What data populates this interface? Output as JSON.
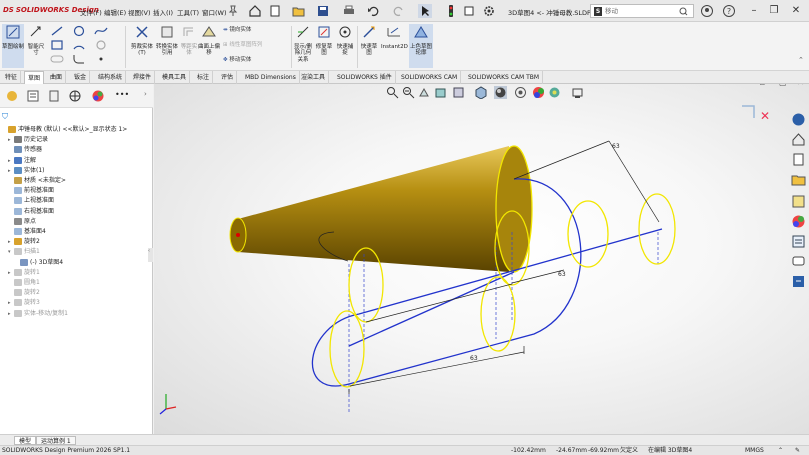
{
  "app": {
    "brand": "SOLIDWORKS Design",
    "document_title": "3D草图4 <- 冲锤母教.SLDPR...",
    "search_placeholder": "移动"
  },
  "menu": [
    "文件(F)",
    "编辑(E)",
    "视图(V)",
    "插入(I)",
    "工具(T)",
    "窗口(W)"
  ],
  "command_manager": {
    "big_buttons": [
      {
        "label": "草图绘制"
      },
      {
        "label": "智能尺寸"
      },
      {
        "label": "剪裁实体(T)"
      },
      {
        "label": "转换实体引用"
      },
      {
        "label": "等距实体"
      },
      {
        "label": "曲面上偏移"
      },
      {
        "label": "显示/删除几何关系"
      },
      {
        "label": "修复草图"
      },
      {
        "label": "快速捕捉"
      },
      {
        "label": "快速草图"
      },
      {
        "label": "Instant2D"
      },
      {
        "label": "上色草图轮廓"
      }
    ],
    "small_items": {
      "mirror": "镜向实体",
      "linear_pattern": "线性草图阵列",
      "move": "移动实体"
    }
  },
  "tabs": [
    "特征",
    "草图",
    "曲面",
    "钣金",
    "结构系统",
    "焊接件",
    "模具工具",
    "标注",
    "评估",
    "MBD Dimensions",
    "渲染工具",
    "SOLIDWORKS 插件",
    "SOLIDWORKS CAM",
    "SOLIDWORKS CAM TBM"
  ],
  "active_tab": "草图",
  "tree": [
    {
      "label": "冲锤母教 (默认) <<默认>_显示状态 1>",
      "indent": 0,
      "color": "#d8a22c",
      "dim": false,
      "exp": ""
    },
    {
      "label": "历史记录",
      "indent": 1,
      "color": "#7a7a7a",
      "dim": false,
      "exp": "▸"
    },
    {
      "label": "传感器",
      "indent": 1,
      "color": "#6f8fb8",
      "dim": false,
      "exp": ""
    },
    {
      "label": "注解",
      "indent": 1,
      "color": "#4a78c2",
      "dim": false,
      "exp": "▸"
    },
    {
      "label": "实体(1)",
      "indent": 1,
      "color": "#5b8ec4",
      "dim": false,
      "exp": "▸"
    },
    {
      "label": "材质 <未指定>",
      "indent": 1,
      "color": "#c4a047",
      "dim": false,
      "exp": ""
    },
    {
      "label": "前视基准面",
      "indent": 1,
      "color": "#9cb7d8",
      "dim": false,
      "exp": ""
    },
    {
      "label": "上视基准面",
      "indent": 1,
      "color": "#9cb7d8",
      "dim": false,
      "exp": ""
    },
    {
      "label": "右视基准面",
      "indent": 1,
      "color": "#9cb7d8",
      "dim": false,
      "exp": ""
    },
    {
      "label": "原点",
      "indent": 1,
      "color": "#8a8a8a",
      "dim": false,
      "exp": ""
    },
    {
      "label": "基准面4",
      "indent": 1,
      "color": "#9cb7d8",
      "dim": false,
      "exp": ""
    },
    {
      "label": "旋转2",
      "indent": 1,
      "color": "#d8a22c",
      "dim": false,
      "exp": "▸"
    },
    {
      "label": "扫描1",
      "indent": 1,
      "color": "#c8c8c8",
      "dim": true,
      "exp": "▾"
    },
    {
      "label": "(-) 3D草图4",
      "indent": 2,
      "color": "#7a95c0",
      "dim": false,
      "exp": ""
    },
    {
      "label": "旋转1",
      "indent": 1,
      "color": "#c8c8c8",
      "dim": true,
      "exp": "▸"
    },
    {
      "label": "圆角1",
      "indent": 1,
      "color": "#c8c8c8",
      "dim": true,
      "exp": ""
    },
    {
      "label": "旋转2",
      "indent": 1,
      "color": "#c8c8c8",
      "dim": true,
      "exp": ""
    },
    {
      "label": "旋转3",
      "indent": 1,
      "color": "#c8c8c8",
      "dim": true,
      "exp": "▸"
    },
    {
      "label": "实体-移动/复制1",
      "indent": 1,
      "color": "#c8c8c8",
      "dim": true,
      "exp": "▸"
    }
  ],
  "viewport": {
    "dim_labels": {
      "d1": "63",
      "d2": "63",
      "d3": "63"
    }
  },
  "bottom_tabs": [
    "模型",
    "运动算例 1"
  ],
  "status": {
    "edition": "SOLIDWORKS Design Premium 2026 SP1.1",
    "x": "-102.42mm",
    "y": "-24.67mm",
    "z": "-69.92mm",
    "state": "欠定义",
    "editing": "在编辑 3D草图4",
    "units": "MMGS"
  },
  "colors": {
    "sketch_blue": "#2233cc",
    "sketch_yellow": "#f2e600",
    "cone_gold": "#a8860a",
    "accent_red": "#c0141b"
  }
}
